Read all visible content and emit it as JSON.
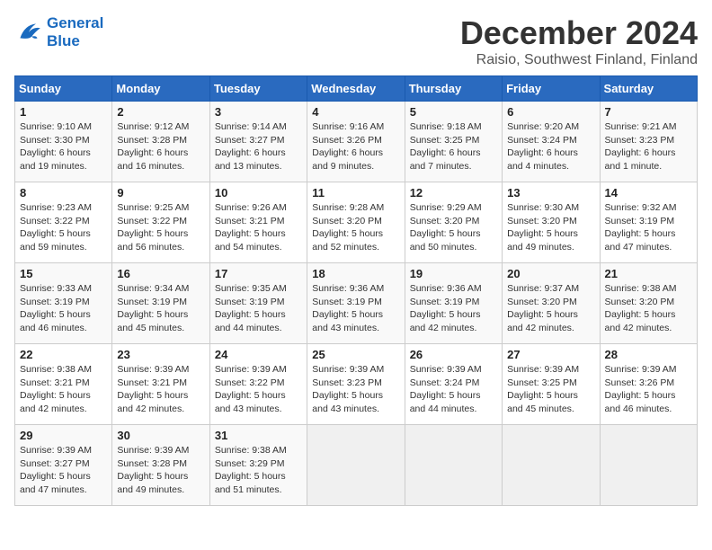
{
  "logo": {
    "line1": "General",
    "line2": "Blue"
  },
  "title": "December 2024",
  "subtitle": "Raisio, Southwest Finland, Finland",
  "weekdays": [
    "Sunday",
    "Monday",
    "Tuesday",
    "Wednesday",
    "Thursday",
    "Friday",
    "Saturday"
  ],
  "weeks": [
    [
      {
        "day": "1",
        "sunrise": "Sunrise: 9:10 AM",
        "sunset": "Sunset: 3:30 PM",
        "daylight": "Daylight: 6 hours and 19 minutes."
      },
      {
        "day": "2",
        "sunrise": "Sunrise: 9:12 AM",
        "sunset": "Sunset: 3:28 PM",
        "daylight": "Daylight: 6 hours and 16 minutes."
      },
      {
        "day": "3",
        "sunrise": "Sunrise: 9:14 AM",
        "sunset": "Sunset: 3:27 PM",
        "daylight": "Daylight: 6 hours and 13 minutes."
      },
      {
        "day": "4",
        "sunrise": "Sunrise: 9:16 AM",
        "sunset": "Sunset: 3:26 PM",
        "daylight": "Daylight: 6 hours and 9 minutes."
      },
      {
        "day": "5",
        "sunrise": "Sunrise: 9:18 AM",
        "sunset": "Sunset: 3:25 PM",
        "daylight": "Daylight: 6 hours and 7 minutes."
      },
      {
        "day": "6",
        "sunrise": "Sunrise: 9:20 AM",
        "sunset": "Sunset: 3:24 PM",
        "daylight": "Daylight: 6 hours and 4 minutes."
      },
      {
        "day": "7",
        "sunrise": "Sunrise: 9:21 AM",
        "sunset": "Sunset: 3:23 PM",
        "daylight": "Daylight: 6 hours and 1 minute."
      }
    ],
    [
      {
        "day": "8",
        "sunrise": "Sunrise: 9:23 AM",
        "sunset": "Sunset: 3:22 PM",
        "daylight": "Daylight: 5 hours and 59 minutes."
      },
      {
        "day": "9",
        "sunrise": "Sunrise: 9:25 AM",
        "sunset": "Sunset: 3:22 PM",
        "daylight": "Daylight: 5 hours and 56 minutes."
      },
      {
        "day": "10",
        "sunrise": "Sunrise: 9:26 AM",
        "sunset": "Sunset: 3:21 PM",
        "daylight": "Daylight: 5 hours and 54 minutes."
      },
      {
        "day": "11",
        "sunrise": "Sunrise: 9:28 AM",
        "sunset": "Sunset: 3:20 PM",
        "daylight": "Daylight: 5 hours and 52 minutes."
      },
      {
        "day": "12",
        "sunrise": "Sunrise: 9:29 AM",
        "sunset": "Sunset: 3:20 PM",
        "daylight": "Daylight: 5 hours and 50 minutes."
      },
      {
        "day": "13",
        "sunrise": "Sunrise: 9:30 AM",
        "sunset": "Sunset: 3:20 PM",
        "daylight": "Daylight: 5 hours and 49 minutes."
      },
      {
        "day": "14",
        "sunrise": "Sunrise: 9:32 AM",
        "sunset": "Sunset: 3:19 PM",
        "daylight": "Daylight: 5 hours and 47 minutes."
      }
    ],
    [
      {
        "day": "15",
        "sunrise": "Sunrise: 9:33 AM",
        "sunset": "Sunset: 3:19 PM",
        "daylight": "Daylight: 5 hours and 46 minutes."
      },
      {
        "day": "16",
        "sunrise": "Sunrise: 9:34 AM",
        "sunset": "Sunset: 3:19 PM",
        "daylight": "Daylight: 5 hours and 45 minutes."
      },
      {
        "day": "17",
        "sunrise": "Sunrise: 9:35 AM",
        "sunset": "Sunset: 3:19 PM",
        "daylight": "Daylight: 5 hours and 44 minutes."
      },
      {
        "day": "18",
        "sunrise": "Sunrise: 9:36 AM",
        "sunset": "Sunset: 3:19 PM",
        "daylight": "Daylight: 5 hours and 43 minutes."
      },
      {
        "day": "19",
        "sunrise": "Sunrise: 9:36 AM",
        "sunset": "Sunset: 3:19 PM",
        "daylight": "Daylight: 5 hours and 42 minutes."
      },
      {
        "day": "20",
        "sunrise": "Sunrise: 9:37 AM",
        "sunset": "Sunset: 3:20 PM",
        "daylight": "Daylight: 5 hours and 42 minutes."
      },
      {
        "day": "21",
        "sunrise": "Sunrise: 9:38 AM",
        "sunset": "Sunset: 3:20 PM",
        "daylight": "Daylight: 5 hours and 42 minutes."
      }
    ],
    [
      {
        "day": "22",
        "sunrise": "Sunrise: 9:38 AM",
        "sunset": "Sunset: 3:21 PM",
        "daylight": "Daylight: 5 hours and 42 minutes."
      },
      {
        "day": "23",
        "sunrise": "Sunrise: 9:39 AM",
        "sunset": "Sunset: 3:21 PM",
        "daylight": "Daylight: 5 hours and 42 minutes."
      },
      {
        "day": "24",
        "sunrise": "Sunrise: 9:39 AM",
        "sunset": "Sunset: 3:22 PM",
        "daylight": "Daylight: 5 hours and 43 minutes."
      },
      {
        "day": "25",
        "sunrise": "Sunrise: 9:39 AM",
        "sunset": "Sunset: 3:23 PM",
        "daylight": "Daylight: 5 hours and 43 minutes."
      },
      {
        "day": "26",
        "sunrise": "Sunrise: 9:39 AM",
        "sunset": "Sunset: 3:24 PM",
        "daylight": "Daylight: 5 hours and 44 minutes."
      },
      {
        "day": "27",
        "sunrise": "Sunrise: 9:39 AM",
        "sunset": "Sunset: 3:25 PM",
        "daylight": "Daylight: 5 hours and 45 minutes."
      },
      {
        "day": "28",
        "sunrise": "Sunrise: 9:39 AM",
        "sunset": "Sunset: 3:26 PM",
        "daylight": "Daylight: 5 hours and 46 minutes."
      }
    ],
    [
      {
        "day": "29",
        "sunrise": "Sunrise: 9:39 AM",
        "sunset": "Sunset: 3:27 PM",
        "daylight": "Daylight: 5 hours and 47 minutes."
      },
      {
        "day": "30",
        "sunrise": "Sunrise: 9:39 AM",
        "sunset": "Sunset: 3:28 PM",
        "daylight": "Daylight: 5 hours and 49 minutes."
      },
      {
        "day": "31",
        "sunrise": "Sunrise: 9:38 AM",
        "sunset": "Sunset: 3:29 PM",
        "daylight": "Daylight: 5 hours and 51 minutes."
      },
      null,
      null,
      null,
      null
    ]
  ]
}
